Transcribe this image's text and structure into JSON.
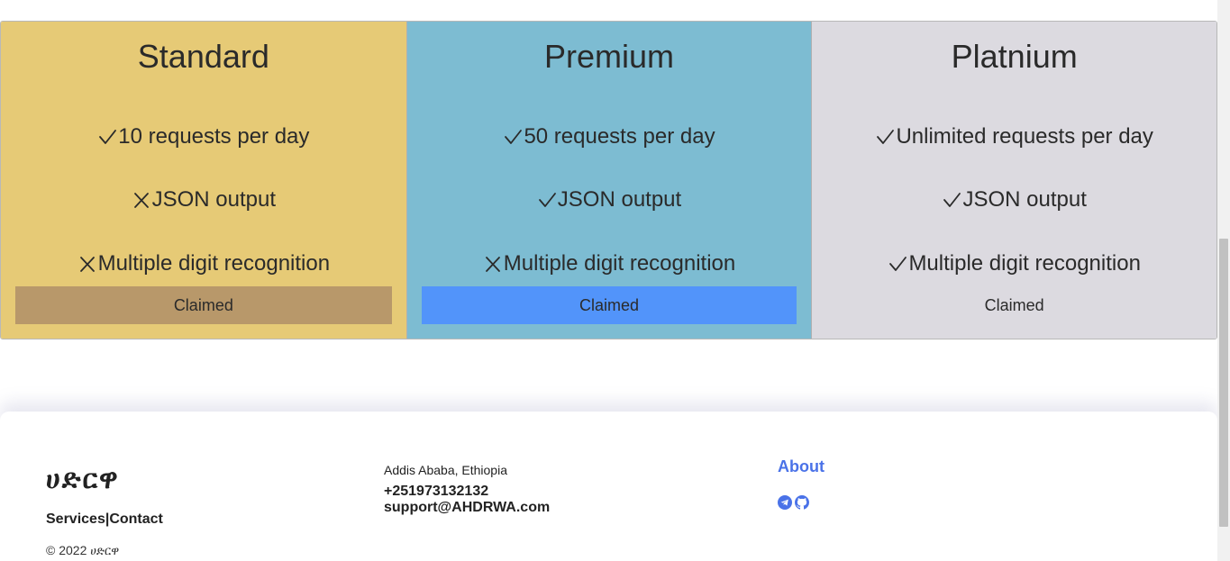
{
  "plans": [
    {
      "title": "Standard",
      "bg": "#e6ca76",
      "button_bg": "#b8986a",
      "features": [
        {
          "label": "10 requests per day",
          "included": true
        },
        {
          "label": "JSON output",
          "included": false
        },
        {
          "label": "Multiple digit recognition",
          "included": false
        }
      ],
      "button_label": "Claimed"
    },
    {
      "title": "Premium",
      "bg": "#7dbcd2",
      "button_bg": "#5294fa",
      "features": [
        {
          "label": "50 requests per day",
          "included": true
        },
        {
          "label": "JSON output",
          "included": true
        },
        {
          "label": "Multiple digit recognition",
          "included": false
        }
      ],
      "button_label": "Claimed"
    },
    {
      "title": "Platnium",
      "bg": "#dcdae0",
      "button_bg": "#dcdae0",
      "features": [
        {
          "label": "Unlimited requests per day",
          "included": true
        },
        {
          "label": "JSON output",
          "included": true
        },
        {
          "label": "Multiple digit recognition",
          "included": true
        }
      ],
      "button_label": "Claimed"
    }
  ],
  "footer": {
    "logo": "ሀድርዋ",
    "links": {
      "services": "Services",
      "separator": "|",
      "contact": "Contact"
    },
    "copyright": "© 2022",
    "copyright_logo": "ሀድርዋ",
    "address": "Addis Ababa, Ethiopia",
    "phone": "+251973132132",
    "email": "support@AHDRWA.com",
    "about": "About",
    "social_icons": [
      "telegram-icon",
      "github-icon"
    ],
    "accent_color": "#4a72e8"
  },
  "icons": {
    "included": "check-icon",
    "excluded": "x-icon"
  }
}
